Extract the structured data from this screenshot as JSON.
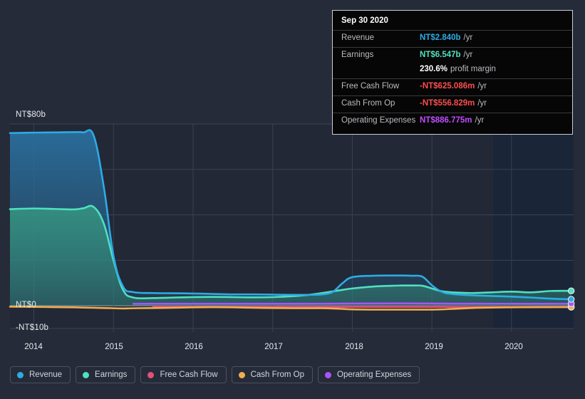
{
  "axis": {
    "y_labels": [
      {
        "text": "NT$80b",
        "value": 80
      },
      {
        "text": "NT$0",
        "value": 0
      },
      {
        "text": "-NT$10b",
        "value": -10
      }
    ],
    "x_labels": [
      "2014",
      "2015",
      "2016",
      "2017",
      "2018",
      "2019",
      "2020"
    ]
  },
  "tooltip": {
    "date": "Sep 30 2020",
    "rows": [
      {
        "label": "Revenue",
        "value": "NT$2.840b",
        "unit": "/yr",
        "color": "#2dabe4"
      },
      {
        "label": "Earnings",
        "value": "NT$6.547b",
        "unit": "/yr",
        "color": "#4fe0c0"
      },
      {
        "label": "",
        "value": "230.6%",
        "sub": "profit margin",
        "color": "#ffffff"
      },
      {
        "label": "Free Cash Flow",
        "value": "-NT$625.086m",
        "unit": "/yr",
        "color": "#ff4d4d"
      },
      {
        "label": "Cash From Op",
        "value": "-NT$556.829m",
        "unit": "/yr",
        "color": "#ff4d4d"
      },
      {
        "label": "Operating Expenses",
        "value": "NT$886.775m",
        "unit": "/yr",
        "color": "#c04dff"
      }
    ]
  },
  "legend": [
    {
      "label": "Revenue",
      "color": "#2dabe4"
    },
    {
      "label": "Earnings",
      "color": "#4fe0c0"
    },
    {
      "label": "Free Cash Flow",
      "color": "#e0527a"
    },
    {
      "label": "Cash From Op",
      "color": "#f0ad4e"
    },
    {
      "label": "Operating Expenses",
      "color": "#a855f7"
    }
  ],
  "chart_data": {
    "type": "area",
    "title": "",
    "xlabel": "",
    "ylabel": "NT$",
    "ylim": [
      -10,
      80
    ],
    "xlim": [
      2013.7,
      2020.78
    ],
    "grid": true,
    "legend_position": "bottom",
    "currency": "NT$",
    "units": "billions",
    "highlight_band": {
      "from": 2019.77,
      "to": 2020.78
    },
    "x": [
      2013.7,
      2014.0,
      2014.25,
      2014.5,
      2014.62,
      2014.75,
      2014.88,
      2015.0,
      2015.12,
      2015.25,
      2015.5,
      2015.75,
      2016.0,
      2016.25,
      2016.5,
      2016.75,
      2017.0,
      2017.25,
      2017.5,
      2017.62,
      2017.75,
      2017.88,
      2018.0,
      2018.25,
      2018.5,
      2018.62,
      2018.75,
      2018.88,
      2019.0,
      2019.12,
      2019.25,
      2019.5,
      2019.75,
      2020.0,
      2020.25,
      2020.5,
      2020.75
    ],
    "series": [
      {
        "name": "Revenue",
        "color": "#2dabe4",
        "values": [
          76.0,
          76.2,
          76.3,
          76.4,
          76.3,
          75.0,
          52.0,
          22.0,
          8.5,
          6.0,
          5.6,
          5.5,
          5.4,
          5.2,
          5.0,
          5.0,
          4.9,
          4.8,
          4.8,
          5.0,
          6.0,
          10.0,
          12.6,
          13.2,
          13.3,
          13.3,
          13.2,
          12.8,
          9.0,
          6.2,
          5.2,
          4.6,
          4.3,
          4.0,
          3.6,
          3.1,
          2.84
        ]
      },
      {
        "name": "Earnings",
        "color": "#4fe0c0",
        "values": [
          42.5,
          42.8,
          42.6,
          42.4,
          42.9,
          43.5,
          36.0,
          20.0,
          7.0,
          3.6,
          3.4,
          3.6,
          3.8,
          3.9,
          3.8,
          3.7,
          3.8,
          4.2,
          5.0,
          5.6,
          6.3,
          7.0,
          7.6,
          8.4,
          8.8,
          8.9,
          8.9,
          8.8,
          7.6,
          6.4,
          5.9,
          5.6,
          5.9,
          6.2,
          5.9,
          6.5,
          6.547
        ]
      },
      {
        "name": "Free Cash Flow",
        "color": "#e0527a",
        "values": [
          null,
          null,
          null,
          null,
          null,
          null,
          null,
          null,
          null,
          null,
          -0.4,
          -0.5,
          -0.5,
          -0.5,
          -0.5,
          -0.5,
          -0.5,
          -0.5,
          -0.5,
          -0.5,
          -0.5,
          -0.5,
          -0.5,
          -0.5,
          -0.5,
          -0.5,
          -0.5,
          -0.5,
          -0.5,
          -0.5,
          -0.55,
          -0.6,
          -0.6,
          -0.6,
          -0.6,
          -0.62,
          -0.625
        ]
      },
      {
        "name": "Cash From Op",
        "color": "#f0ad4e",
        "values": [
          -0.4,
          -0.5,
          -0.6,
          -0.7,
          -0.8,
          -0.9,
          -1.0,
          -1.1,
          -1.2,
          -1.1,
          -1.0,
          -0.9,
          -0.7,
          -0.6,
          -0.7,
          -0.9,
          -1.0,
          -1.1,
          -1.1,
          -1.1,
          -1.2,
          -1.4,
          -1.6,
          -1.7,
          -1.7,
          -1.7,
          -1.7,
          -1.7,
          -1.7,
          -1.6,
          -1.4,
          -1.0,
          -0.8,
          -0.7,
          -0.65,
          -0.6,
          -0.557
        ]
      },
      {
        "name": "Operating Expenses",
        "color": "#a855f7",
        "values": [
          null,
          null,
          null,
          null,
          null,
          null,
          null,
          null,
          null,
          0.85,
          0.87,
          0.88,
          0.88,
          0.88,
          0.88,
          0.88,
          0.88,
          0.88,
          0.89,
          0.9,
          0.92,
          0.95,
          0.98,
          1.0,
          1.02,
          1.02,
          1.02,
          1.0,
          0.98,
          0.95,
          0.93,
          0.91,
          0.9,
          0.89,
          0.89,
          0.89,
          0.887
        ]
      }
    ]
  }
}
